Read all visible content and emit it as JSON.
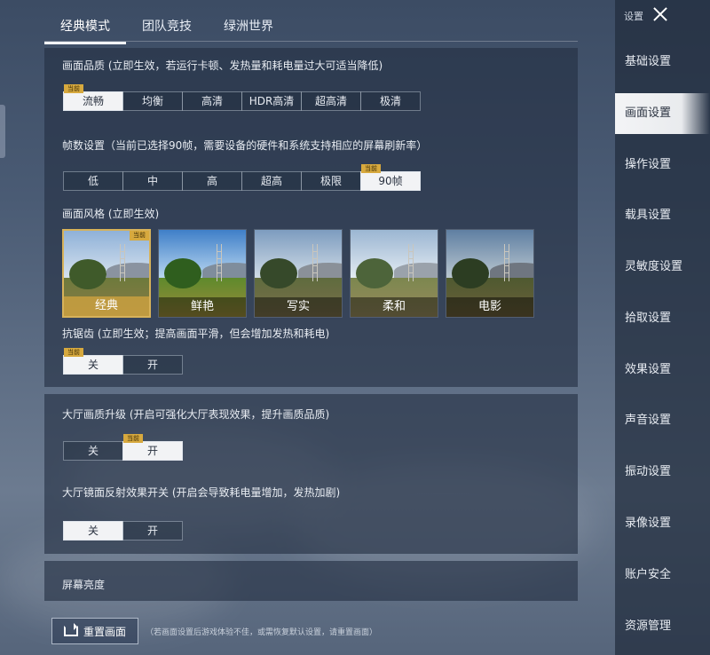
{
  "tabs": [
    "经典模式",
    "团队竞技",
    "绿洲世界"
  ],
  "quality": {
    "label": "画面品质 (立即生效，若运行卡顿、发热量和耗电量过大可适当降低)",
    "options": [
      "流畅",
      "均衡",
      "高清",
      "HDR高清",
      "超高清",
      "极清"
    ],
    "selected_index": 0
  },
  "framerate": {
    "label": "帧数设置（当前已选择90帧，需要设备的硬件和系统支持相应的屏幕刷新率）",
    "options": [
      "低",
      "中",
      "高",
      "超高",
      "极限",
      "90帧"
    ],
    "selected_index": 5
  },
  "style": {
    "label": "画面风格 (立即生效)",
    "options": [
      "经典",
      "鲜艳",
      "写实",
      "柔和",
      "电影"
    ],
    "selected_index": 0
  },
  "antialias": {
    "label": "抗锯齿 (立即生效；提高画面平滑，但会增加发热和耗电)",
    "options": [
      "关",
      "开"
    ],
    "selected_index": 0
  },
  "lobby_upgrade": {
    "label": "大厅画质升级 (开启可强化大厅表现效果，提升画质品质)",
    "options": [
      "关",
      "开"
    ],
    "selected_index": 1
  },
  "lobby_reflection": {
    "label": "大厅镜面反射效果开关 (开启会导致耗电量增加，发热加剧)",
    "options": [
      "关",
      "开"
    ],
    "selected_index": 0
  },
  "brightness": {
    "label": "屏幕亮度"
  },
  "current_badge": "当前",
  "reset": {
    "label": "重置画面",
    "note": "（若画面设置后游戏体验不佳，或需恢复默认设置，请重置画面）"
  },
  "sidebar": {
    "title": "设置",
    "items": [
      "基础设置",
      "画面设置",
      "操作设置",
      "载具设置",
      "灵敏度设置",
      "拾取设置",
      "效果设置",
      "声音设置",
      "振动设置",
      "录像设置",
      "账户安全",
      "资源管理"
    ],
    "active_index": 1
  },
  "colors": {
    "accent": "#d7a93e",
    "panel": "#232f42",
    "selected": "#f2f3f5"
  }
}
